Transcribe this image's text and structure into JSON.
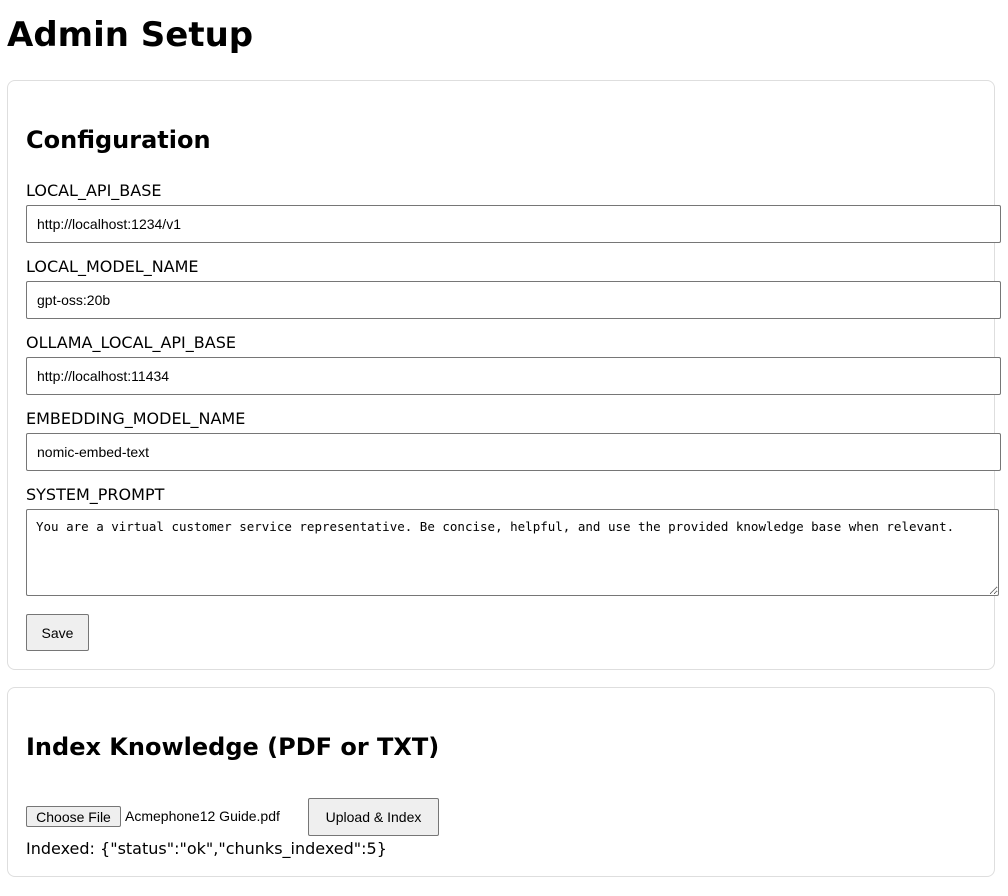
{
  "page": {
    "title": "Admin Setup"
  },
  "configuration": {
    "title": "Configuration",
    "fields": [
      {
        "label": "LOCAL_API_BASE",
        "value": "http://localhost:1234/v1"
      },
      {
        "label": "LOCAL_MODEL_NAME",
        "value": "gpt-oss:20b"
      },
      {
        "label": "OLLAMA_LOCAL_API_BASE",
        "value": "http://localhost:11434"
      },
      {
        "label": "EMBEDDING_MODEL_NAME",
        "value": "nomic-embed-text"
      }
    ],
    "system_prompt": {
      "label": "SYSTEM_PROMPT",
      "value": "You are a virtual customer service representative. Be concise, helpful, and use the provided knowledge base when relevant."
    },
    "save_label": "Save"
  },
  "index": {
    "title": "Index Knowledge (PDF or TXT)",
    "choose_file_label": "Choose File",
    "file_name": "Acmephone12 Guide.pdf",
    "upload_label": "Upload & Index",
    "status": "Indexed: {\"status\":\"ok\",\"chunks_indexed\":5}"
  },
  "colors": {
    "card_border": "#dedede",
    "input_border": "#767676",
    "button_bg": "#efefef"
  }
}
